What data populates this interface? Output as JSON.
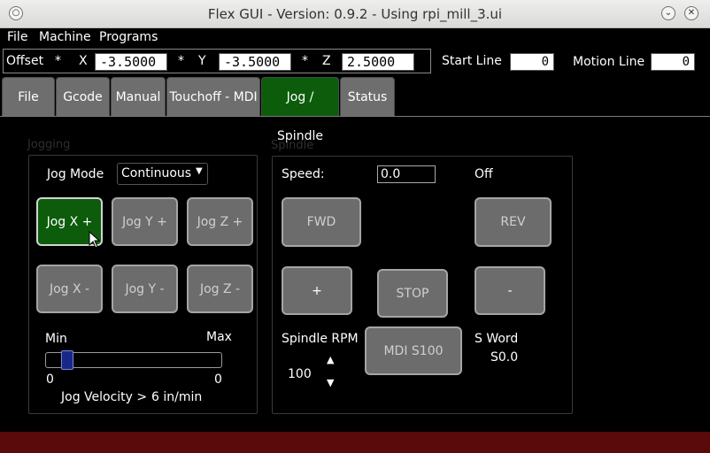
{
  "window": {
    "title": "Flex GUI - Version: 0.9.2 - Using rpi_mill_3.ui"
  },
  "menubar": {
    "items": [
      "File",
      "Machine",
      "Programs"
    ]
  },
  "dro": {
    "offset_label": "Offset",
    "x": {
      "star": "*",
      "label": "X",
      "value": "-3.5000"
    },
    "y": {
      "star": "*",
      "label": "Y",
      "value": "-3.5000"
    },
    "z": {
      "star": "*",
      "label": "Z",
      "value": "2.5000"
    },
    "start_line": {
      "label": "Start Line",
      "value": "0"
    },
    "motion_line": {
      "label": "Motion Line",
      "value": "0"
    }
  },
  "tabs": [
    {
      "label": "File"
    },
    {
      "label": "Gcode"
    },
    {
      "label": "Manual"
    },
    {
      "label": "Touchoff - MDI"
    },
    {
      "label": "Jog / Spindle",
      "active": true
    },
    {
      "label": "Status"
    }
  ],
  "jogging": {
    "title": "Jogging",
    "mode_label": "Jog Mode",
    "mode_value": "Continuous",
    "buttons": {
      "xp": "Jog X +",
      "yp": "Jog Y +",
      "zp": "Jog Z +",
      "xm": "Jog X -",
      "ym": "Jog Y -",
      "zm": "Jog Z -"
    },
    "min_label": "Min",
    "max_label": "Max",
    "min_value": "0",
    "max_value": "0",
    "slider_fraction": 0.08,
    "velocity_label": "Jog Velocity >",
    "velocity_value": "6 in/min"
  },
  "spindle": {
    "title": "Spindle",
    "speed_label": "Speed:",
    "speed_value": "0.0",
    "state": "Off",
    "fwd": "FWD",
    "rev": "REV",
    "plus": "+",
    "stop": "STOP",
    "minus": "-",
    "rpm_label": "Spindle RPM",
    "rpm_value": "100",
    "mdi_button": "MDI S100",
    "sword_label": "S Word",
    "sword_value": "S0.0"
  },
  "colors": {
    "active_green": "#0c5c0c",
    "footer_red": "#5a0a0a",
    "slider_blue": "#18288a"
  }
}
